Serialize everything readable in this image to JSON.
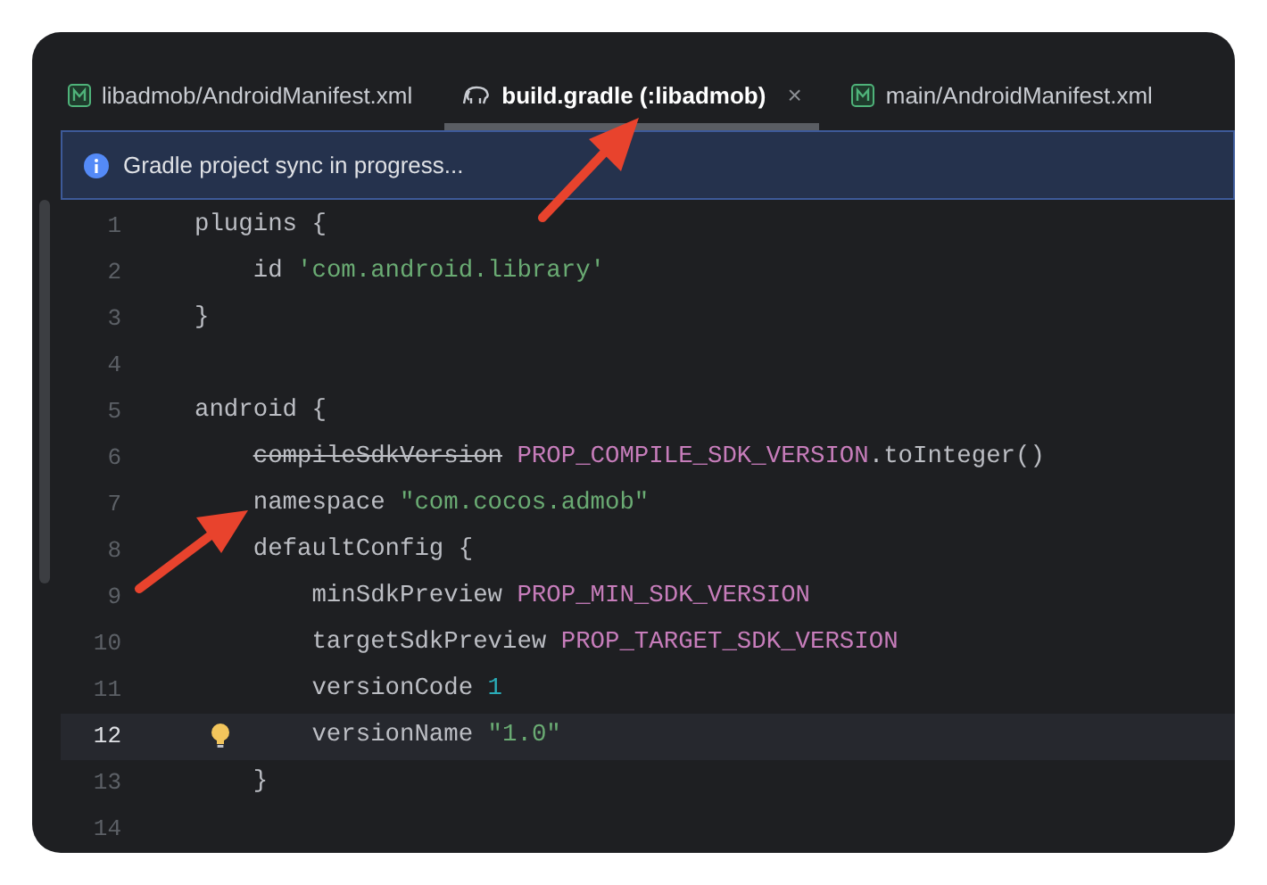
{
  "tabs": [
    {
      "label": "libadmob/AndroidManifest.xml",
      "kind": "manifest",
      "selected": false
    },
    {
      "label": "build.gradle (:libadmob)",
      "kind": "gradle",
      "selected": true,
      "close": "×"
    },
    {
      "label": "main/AndroidManifest.xml",
      "kind": "manifest",
      "selected": false
    }
  ],
  "banner": {
    "text": "Gradle project sync in progress..."
  },
  "lines": [
    {
      "number": "1",
      "current": false,
      "tokens": [
        {
          "kind": "plain",
          "text": "plugins {"
        }
      ]
    },
    {
      "number": "2",
      "current": false,
      "tokens": [
        {
          "kind": "plain",
          "text": "    id "
        },
        {
          "kind": "string",
          "text": "'com.android.library'"
        }
      ]
    },
    {
      "number": "3",
      "current": false,
      "tokens": [
        {
          "kind": "plain",
          "text": "}"
        }
      ]
    },
    {
      "number": "4",
      "current": false
    },
    {
      "number": "5",
      "current": false,
      "tokens": [
        {
          "kind": "plain",
          "text": "android {"
        }
      ]
    },
    {
      "number": "6",
      "current": false,
      "tokens": [
        {
          "kind": "deprecated",
          "text": "    compileSdkVersion"
        },
        {
          "kind": "constant",
          "text": " PROP_COMPILE_SDK_VERSION"
        },
        {
          "kind": "plain",
          "text": ".toInteger()"
        }
      ]
    },
    {
      "number": "7",
      "current": false,
      "tokens": [
        {
          "kind": "plain",
          "text": "    namespace "
        },
        {
          "kind": "string",
          "text": "\"com.cocos.admob\""
        }
      ]
    },
    {
      "number": "8",
      "current": false,
      "tokens": [
        {
          "kind": "plain",
          "text": "    defaultConfig {"
        }
      ]
    },
    {
      "number": "9",
      "current": false,
      "tokens": [
        {
          "kind": "plain",
          "text": "        minSdkPreview "
        },
        {
          "kind": "constant",
          "text": "PROP_MIN_SDK_VERSION"
        }
      ]
    },
    {
      "number": "10",
      "current": false,
      "tokens": [
        {
          "kind": "plain",
          "text": "        targetSdkPreview "
        },
        {
          "kind": "constant",
          "text": "PROP_TARGET_SDK_VERSION"
        }
      ]
    },
    {
      "number": "11",
      "current": false,
      "tokens": [
        {
          "kind": "plain",
          "text": "        versionCode "
        },
        {
          "kind": "number",
          "text": "1"
        }
      ]
    },
    {
      "number": "12",
      "current": true,
      "bulb": true,
      "tokens": [
        {
          "kind": "plain",
          "text": "        versionName "
        },
        {
          "kind": "string",
          "text": "\"1.0\""
        }
      ]
    },
    {
      "number": "13",
      "current": false,
      "tokens": [
        {
          "kind": "plain",
          "text": "    }"
        }
      ]
    },
    {
      "number": "14",
      "current": false
    }
  ]
}
